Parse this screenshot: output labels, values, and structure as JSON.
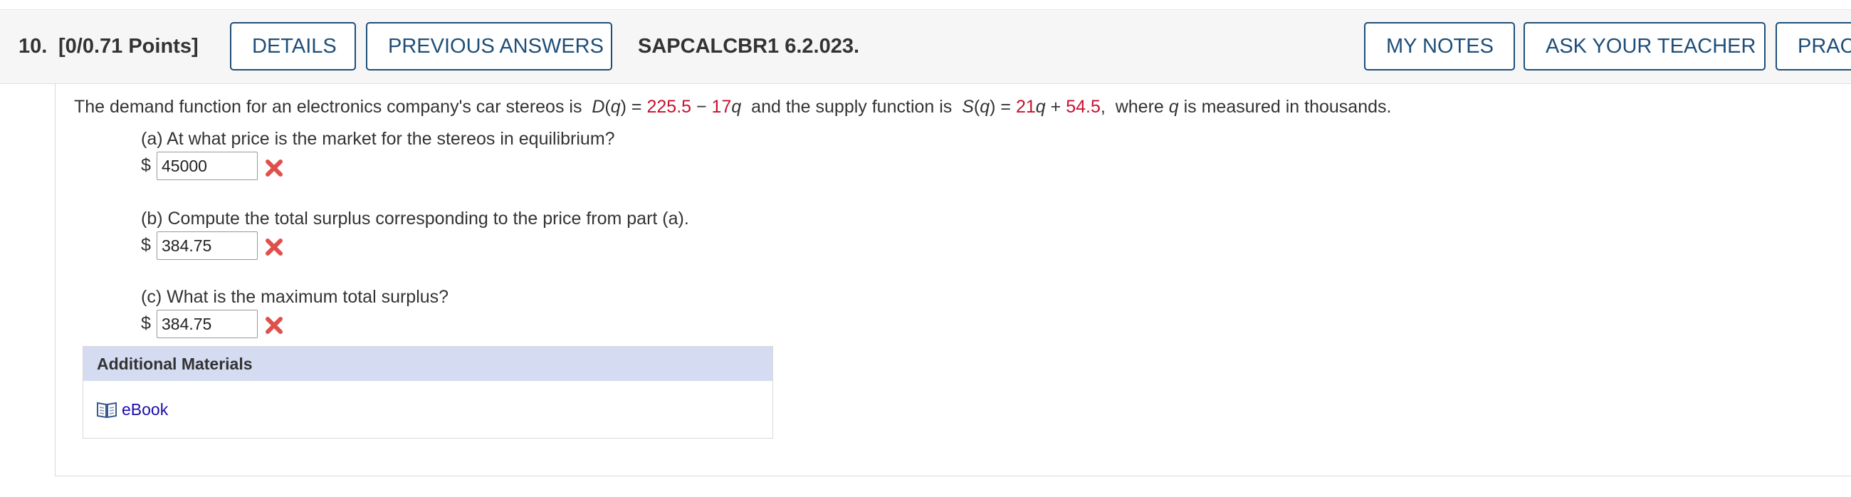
{
  "header": {
    "question_number": "10.",
    "points": "[0/0.71 Points]",
    "details_label": "DETAILS",
    "previous_answers_label": "PREVIOUS ANSWERS",
    "problem_code": "SAPCALCBR1 6.2.023.",
    "my_notes_label": "MY NOTES",
    "ask_teacher_label": "ASK YOUR TEACHER",
    "practice_label": "PRAC"
  },
  "problem": {
    "intro": "The demand function for an electronics company's car stereos is",
    "demand_fn": "D",
    "var": "q",
    "demand_const": "225.5",
    "demand_coef": "17",
    "mid_text": "and the supply function is",
    "supply_fn": "S",
    "supply_coef": "21",
    "supply_const": "54.5",
    "tail_prefix": "where",
    "tail_suffix": "is measured in thousands."
  },
  "parts": [
    {
      "label": "(a) At what price is the market for the stereos in equilibrium?",
      "currency": "$",
      "answer": "45000",
      "status_icon": "incorrect-x-icon"
    },
    {
      "label": "(b) Compute the total surplus corresponding to the price from part (a).",
      "currency": "$",
      "answer": "384.75",
      "status_icon": "incorrect-x-icon"
    },
    {
      "label": "(c) What is the maximum total surplus?",
      "currency": "$",
      "answer": "384.75",
      "status_icon": "incorrect-x-icon"
    }
  ],
  "additional_materials": {
    "heading": "Additional Materials",
    "ebook_label": "eBook",
    "ebook_icon": "book-icon"
  },
  "colors": {
    "accent": "#1f4e79",
    "value_red": "#c8102e",
    "incorrect": "#e0504b",
    "header_bg": "#f6f6f6",
    "materials_bg": "#d5dcf2",
    "link": "#1a0dab"
  }
}
